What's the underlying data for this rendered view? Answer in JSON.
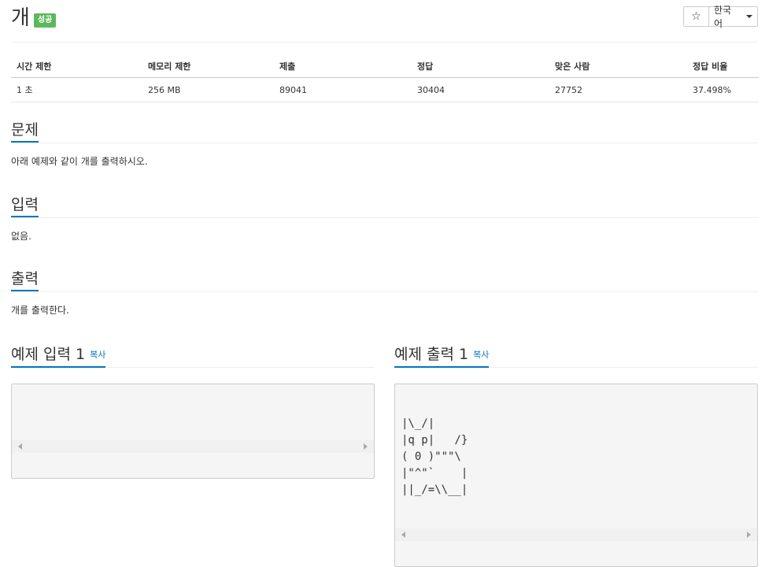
{
  "header": {
    "title": "개",
    "badge": "성공",
    "star_icon": "☆",
    "language": "한국어"
  },
  "info": {
    "headers": [
      "시간 제한",
      "메모리 제한",
      "제출",
      "정답",
      "맞은 사람",
      "정답 비율"
    ],
    "values": [
      "1 초",
      "256 MB",
      "89041",
      "30404",
      "27752",
      "37.498%"
    ]
  },
  "problem": {
    "heading": "문제",
    "text": "아래 예제와 같이 개를 출력하시오."
  },
  "input": {
    "heading": "입력",
    "text": "없음."
  },
  "output": {
    "heading": "출력",
    "text": "개를 출력한다."
  },
  "sample_input": {
    "heading": "예제 입력 1",
    "copy": "복사",
    "content": ""
  },
  "sample_output": {
    "heading": "예제 출력 1",
    "copy": "복사",
    "content": "|\\_/|\n|q p|   /}\n( 0 )\"\"\"\\\n|\"^\"`    |\n||_/=\\\\__|"
  }
}
